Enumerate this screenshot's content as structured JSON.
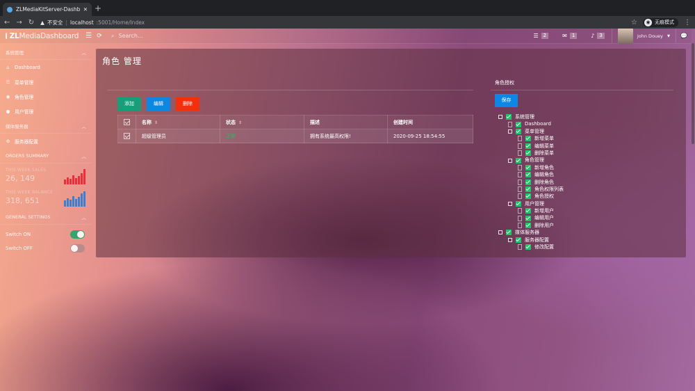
{
  "browser": {
    "tab_title": "ZLMediaKitServer-Dashboard",
    "security": "不安全",
    "url_host": "localhost",
    "url_path": ":5001/Home/Index",
    "incognito_label": "无痕模式"
  },
  "topbar": {
    "brand_bold": "ZL",
    "brand_rest": "MediaDashboard",
    "search_placeholder": "Search...",
    "tasks_count": "2",
    "messages_count": "1",
    "notifications_count": "3",
    "user_name": "John Douey"
  },
  "sidebar": {
    "section1": "系统管理",
    "items1": [
      {
        "label": "Dashboard",
        "icon": "home-icon"
      },
      {
        "label": "菜单管理",
        "icon": "list-icon"
      },
      {
        "label": "角色管理",
        "icon": "eye-icon"
      },
      {
        "label": "用户管理",
        "icon": "user-icon"
      }
    ],
    "section2": "媒体服务器",
    "items2": [
      {
        "label": "服务器配置",
        "icon": "cogs-icon"
      }
    ],
    "section3": "ORDERS SUMMARY",
    "stats": [
      {
        "label": "THIS WEEK SALES",
        "value": "26, 149",
        "bars": [
          30,
          45,
          35,
          60,
          40,
          55,
          75,
          100
        ],
        "color": "#e8303a"
      },
      {
        "label": "THIS WEEK BALANCE",
        "value": "318, 651",
        "bars": [
          40,
          55,
          45,
          70,
          50,
          65,
          85,
          100
        ],
        "color": "#3b7fd0"
      }
    ],
    "section4": "GENERAL SETTINGS",
    "switch_on": "Switch ON",
    "switch_off": "Switch OFF"
  },
  "main": {
    "page_title": "角色 管理",
    "buttons": {
      "add": "添加",
      "edit": "编辑",
      "delete": "删除"
    },
    "table": {
      "headers": [
        "名称",
        "状态",
        "描述",
        "创建时间"
      ],
      "rows": [
        {
          "name": "超级管理员",
          "status": "正常",
          "desc": "拥有系统最高权限!",
          "created": "2020-09-25 18:54:55"
        }
      ]
    },
    "permissions": {
      "title": "角色授权",
      "save": "保存",
      "tree": [
        {
          "label": "系统管理",
          "level": 0,
          "type": "folder"
        },
        {
          "label": "Dashboard",
          "level": 1,
          "type": "leaf"
        },
        {
          "label": "菜单管理",
          "level": 1,
          "type": "folder"
        },
        {
          "label": "新增菜单",
          "level": 2,
          "type": "leaf"
        },
        {
          "label": "编辑菜单",
          "level": 2,
          "type": "leaf"
        },
        {
          "label": "删除菜单",
          "level": 2,
          "type": "leaf"
        },
        {
          "label": "角色管理",
          "level": 1,
          "type": "folder"
        },
        {
          "label": "新增角色",
          "level": 2,
          "type": "leaf"
        },
        {
          "label": "编辑角色",
          "level": 2,
          "type": "leaf"
        },
        {
          "label": "删除角色",
          "level": 2,
          "type": "leaf"
        },
        {
          "label": "角色权限列表",
          "level": 2,
          "type": "leaf"
        },
        {
          "label": "角色授权",
          "level": 2,
          "type": "leaf"
        },
        {
          "label": "用户管理",
          "level": 1,
          "type": "folder"
        },
        {
          "label": "新增用户",
          "level": 2,
          "type": "leaf"
        },
        {
          "label": "编辑用户",
          "level": 2,
          "type": "leaf"
        },
        {
          "label": "删除用户",
          "level": 2,
          "type": "leaf"
        },
        {
          "label": "媒体服务器",
          "level": 0,
          "type": "folder"
        },
        {
          "label": "服务器配置",
          "level": 1,
          "type": "folder"
        },
        {
          "label": "修改配置",
          "level": 2,
          "type": "leaf"
        }
      ]
    }
  }
}
